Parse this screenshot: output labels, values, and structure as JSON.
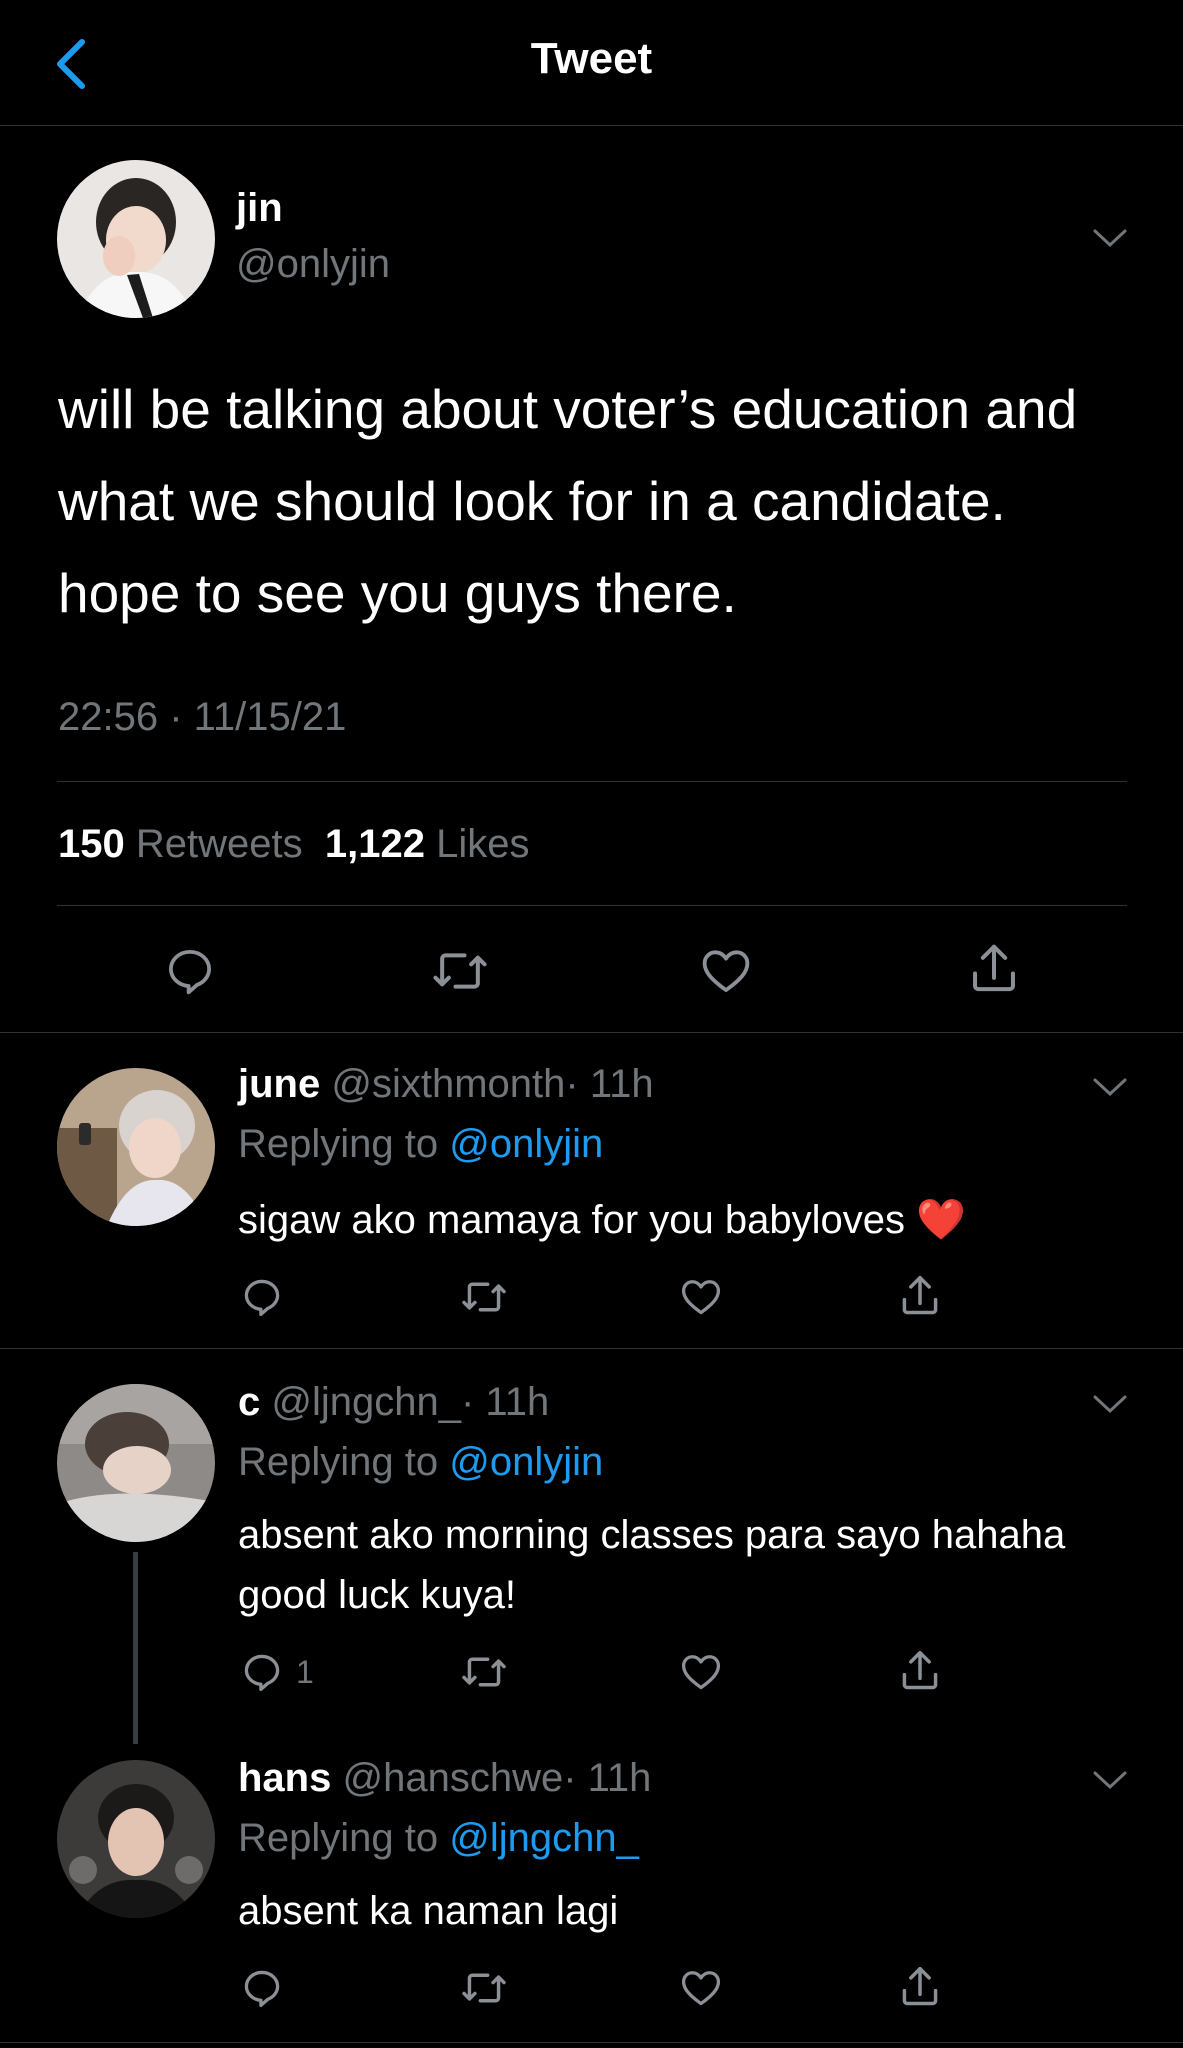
{
  "header": {
    "title": "Tweet",
    "back_icon": "chevron-left-icon"
  },
  "colors": {
    "background": "#000000",
    "accent": "#1d9bf0",
    "muted": "#71767b",
    "like": "#e0245e"
  },
  "main_tweet": {
    "name": "jin",
    "handle": "@onlyjin",
    "text": "will be talking about voter’s education and what we should look for in a candidate. hope to see you guys there.",
    "timestamp": "22:56 · 11/15/21",
    "retweets_count": "150",
    "retweets_label": "Retweets",
    "likes_count": "1,122",
    "likes_label": "Likes"
  },
  "replies": [
    {
      "name": "june",
      "handle": "@sixthmonth",
      "time": "· 11h",
      "replying_label": "Replying to",
      "replying_to": "@onlyjin",
      "text": "sigaw ako mamaya for you babyloves",
      "emoji": "❤️",
      "reply_count": ""
    },
    {
      "name": "c",
      "handle": "@ljngchn_",
      "time": "· 11h",
      "replying_label": "Replying to",
      "replying_to": "@onlyjin",
      "text": "absent ako morning classes para sayo hahaha good luck kuya!",
      "reply_count": "1"
    },
    {
      "name": "hans",
      "handle": "@hanschwe",
      "time": "· 11h",
      "replying_label": "Replying to",
      "replying_to": "@ljngchn_",
      "text": "absent ka naman lagi",
      "reply_count": ""
    }
  ]
}
